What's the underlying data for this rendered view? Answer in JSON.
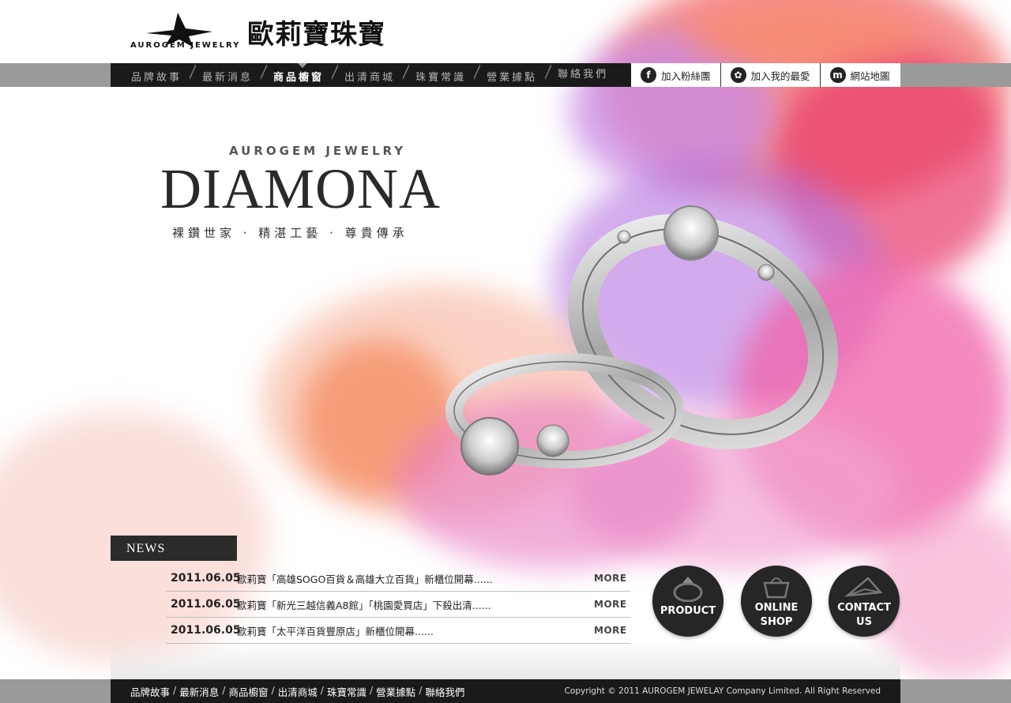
{
  "logo": {
    "en": "AUROGEM JEWELRY",
    "cn": "歐莉寶珠寶"
  },
  "nav": {
    "items": [
      {
        "label": "品牌故事",
        "active": false
      },
      {
        "label": "最新消息",
        "active": false
      },
      {
        "label": "商品櫥窗",
        "active": true
      },
      {
        "label": "出清商城",
        "active": false
      },
      {
        "label": "珠寶常識",
        "active": false
      },
      {
        "label": "營業據點",
        "active": false
      },
      {
        "label": "聯絡我們",
        "active": false
      }
    ]
  },
  "social": {
    "items": [
      {
        "icon": "facebook-icon",
        "glyph": "f",
        "label": "加入粉絲團"
      },
      {
        "icon": "favorite-bird-icon",
        "glyph": "✿",
        "label": "加入我的最愛"
      },
      {
        "icon": "sitemap-icon",
        "glyph": "m",
        "label": "網站地圖"
      }
    ]
  },
  "hero": {
    "brand_en": "AUROGEM JEWELRY",
    "title": "DIAMONA",
    "tagline": "裸鑽世家 · 精湛工藝 · 尊貴傳承"
  },
  "news": {
    "title": "NEWS",
    "more_label": "MORE",
    "items": [
      {
        "date": "2011.06.05",
        "text": "歐莉寶「高雄SOGO百貨＆高雄大立百貨」新櫃位開幕......"
      },
      {
        "date": "2011.06.05",
        "text": "歐莉寶「新光三越信義A8館」「桃園愛買店」下殺出清......"
      },
      {
        "date": "2011.06.05",
        "text": "歐莉寶「太平洋百貨豐原店」新櫃位開幕......"
      }
    ]
  },
  "buttons": {
    "product": "PRODUCT",
    "online_shop_1": "ONLINE",
    "online_shop_2": "SHOP",
    "contact_1": "CONTACT",
    "contact_2": "US"
  },
  "footer": {
    "links": [
      "品牌故事",
      "最新消息",
      "商品櫥窗",
      "出清商城",
      "珠寶常識",
      "營業據點",
      "聯絡我們"
    ],
    "copyright": "Copyright © 2011 AUROGEM JEWELAY Company Limited. All Right Reserved"
  }
}
